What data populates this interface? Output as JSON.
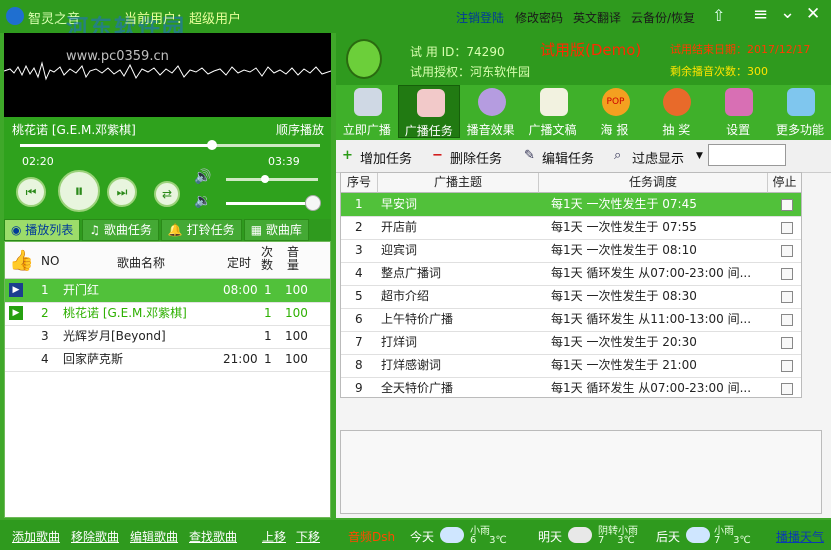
{
  "app": {
    "title": "智灵之音",
    "watermark": "河东软件园",
    "watermark_url": "www.pc0359.cn",
    "current_user_label": "当前用户：超级用户"
  },
  "topmenu": [
    "注销登陆",
    "修改密码",
    "英文翻译",
    "云备份/恢复"
  ],
  "window_controls": [
    "rocket-icon",
    "menu-icon",
    "minimize-icon",
    "close-icon"
  ],
  "player": {
    "track_title": "桃花诺 [G.E.M.邓紫棋]",
    "mode": "顺序播放",
    "elapsed": "02:20",
    "duration": "03:39",
    "progress": 0.64,
    "volume": 0.42,
    "balance": 0.95
  },
  "left_tabs": [
    "播放列表",
    "歌曲任务",
    "打铃任务",
    "歌曲库"
  ],
  "song_table": {
    "headers": [
      "NO",
      "歌曲名称",
      "定时",
      "次数",
      "音量"
    ],
    "rows": [
      {
        "no": "1",
        "name": "开门红",
        "time": "08:00",
        "count": "1",
        "vol": "100"
      },
      {
        "no": "2",
        "name": "桃花诺 [G.E.M.邓紫棋]",
        "time": "",
        "count": "1",
        "vol": "100"
      },
      {
        "no": "3",
        "name": "光辉岁月[Beyond]",
        "time": "",
        "count": "1",
        "vol": "100"
      },
      {
        "no": "4",
        "name": "回家萨克斯",
        "time": "21:00",
        "count": "1",
        "vol": "100"
      }
    ]
  },
  "info": {
    "trial_id": "试 用 ID：74290",
    "trial_auth": "试用授权：河东软件园",
    "edition": "试用版(Demo)",
    "end_date": "试用结束日期：2017/12/17",
    "remaining": "剩余播音次数：300"
  },
  "toolbar": [
    "立即广播",
    "广播任务",
    "播音效果",
    "广播文稿",
    "海 报",
    "抽 奖",
    "设置",
    "更多功能"
  ],
  "toolbar_badges": {
    "pop": "POP"
  },
  "actions": [
    "增加任务",
    "删除任务",
    "编辑任务",
    "过虑显示"
  ],
  "task_table": {
    "headers": [
      "序号",
      "广播主题",
      "任务调度",
      "停止"
    ],
    "rows": [
      {
        "no": "1",
        "topic": "早安词",
        "sched": "每1天  一次性发生于  07:45"
      },
      {
        "no": "2",
        "topic": "开店前",
        "sched": "每1天  一次性发生于  07:55"
      },
      {
        "no": "3",
        "topic": "迎宾词",
        "sched": "每1天  一次性发生于  08:10"
      },
      {
        "no": "4",
        "topic": "整点广播词",
        "sched": "每1天  循环发生  从07:00-23:00  间..."
      },
      {
        "no": "5",
        "topic": "超市介绍",
        "sched": "每1天  一次性发生于  08:30"
      },
      {
        "no": "6",
        "topic": "上午特价广播",
        "sched": "每1天  循环发生  从11:00-13:00  间..."
      },
      {
        "no": "7",
        "topic": "打烊词",
        "sched": "每1天  一次性发生于  20:30"
      },
      {
        "no": "8",
        "topic": "打烊感谢词",
        "sched": "每1天  一次性发生于  21:00"
      },
      {
        "no": "9",
        "topic": "全天特价广播",
        "sched": "每1天  循环发生  从07:00-23:00  间..."
      }
    ]
  },
  "bottom": {
    "links": [
      "添加歌曲",
      "移除歌曲",
      "编辑歌曲",
      "查找歌曲",
      "上移",
      "下移"
    ],
    "status": "音频Dsh",
    "weather": [
      {
        "day": "今天",
        "desc": "小雨",
        "temp": "6    3℃"
      },
      {
        "day": "明天",
        "desc": "阴转小雨",
        "temp": "7    3℃"
      },
      {
        "day": "后天",
        "desc": "小雨",
        "temp": "7    3℃"
      }
    ],
    "weather_link": "播播天气"
  },
  "colors": {
    "accent": "#3fa82a",
    "selected": "#51c13a",
    "playing": "#2db000",
    "edition": "#ff2a00"
  }
}
